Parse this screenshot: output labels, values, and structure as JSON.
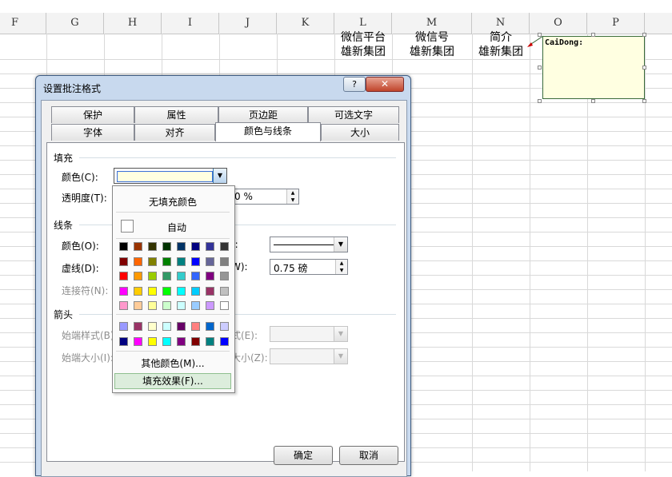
{
  "sheet": {
    "columns": [
      "F",
      "G",
      "H",
      "I",
      "J",
      "K",
      "L",
      "M",
      "N",
      "O",
      "P"
    ],
    "cells": {
      "L1": "微信平台",
      "M1": "微信号",
      "N1": "简介",
      "L2": "雄新集团",
      "M2": "雄新集团",
      "N2": "雄新集团"
    },
    "comment": {
      "author": "CaiDong:"
    }
  },
  "dialog": {
    "title": "设置批注格式",
    "help_label": "?",
    "close_label": "✕",
    "tabs_row1": [
      "保护",
      "属性",
      "页边距",
      "可选文字"
    ],
    "tabs_row2": [
      "字体",
      "对齐",
      "颜色与线条",
      "大小"
    ],
    "active_tab": "颜色与线条",
    "fill_section": "填充",
    "fill_color_label": "颜色(C):",
    "transparency_label": "透明度(T):",
    "transparency_value": "0 %",
    "line_section": "线条",
    "line_color_label": "颜色(O):",
    "dash_label": "虚线(D):",
    "connector_label": "连接符(N):",
    "line_style_label": "):",
    "line_weight_label": "W):",
    "line_weight_value": "0.75 磅",
    "arrow_section": "箭头",
    "begin_style_label": "始端样式(B)",
    "begin_size_label": "始端大小(I):",
    "end_style_label": "式(E):",
    "end_size_label": "大小(Z):",
    "ok_label": "确定",
    "cancel_label": "取消"
  },
  "color_dropdown": {
    "no_fill": "无填充颜色",
    "automatic": "自动",
    "more_colors": "其他颜色(M)...",
    "fill_effects": "填充效果(F)...",
    "theme_colors": [
      [
        "#000000",
        "#993300",
        "#333300",
        "#003300",
        "#003366",
        "#000080",
        "#333399",
        "#333333"
      ],
      [
        "#800000",
        "#ff6600",
        "#808000",
        "#008000",
        "#008080",
        "#0000ff",
        "#666699",
        "#808080"
      ],
      [
        "#ff0000",
        "#ff9900",
        "#99cc00",
        "#339966",
        "#33cccc",
        "#3366ff",
        "#800080",
        "#969696"
      ],
      [
        "#ff00ff",
        "#ffcc00",
        "#ffff00",
        "#00ff00",
        "#00ffff",
        "#00ccff",
        "#993366",
        "#c0c0c0"
      ],
      [
        "#ff99cc",
        "#ffcc99",
        "#ffff99",
        "#ccffcc",
        "#ccffff",
        "#99ccff",
        "#cc99ff",
        "#ffffff"
      ]
    ],
    "recent_colors": [
      [
        "#9999ff",
        "#993366",
        "#ffffcc",
        "#ccffff",
        "#660066",
        "#ff8080",
        "#0066cc",
        "#ccccff"
      ],
      [
        "#000080",
        "#ff00ff",
        "#ffff00",
        "#00ffff",
        "#800080",
        "#800000",
        "#008080",
        "#0000ff"
      ]
    ]
  }
}
